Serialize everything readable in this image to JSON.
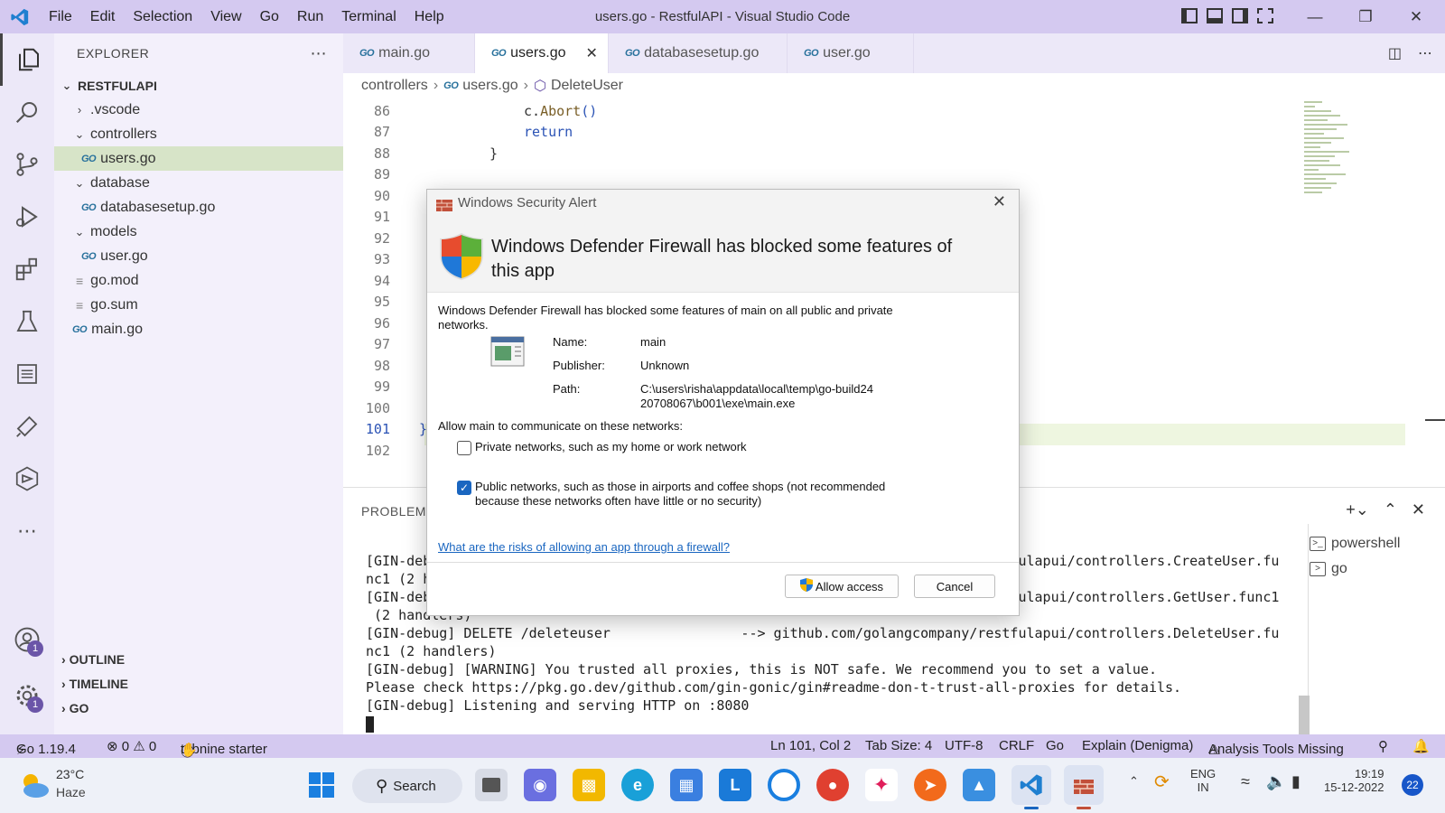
{
  "titlebar": {
    "menu": [
      "File",
      "Edit",
      "Selection",
      "View",
      "Go",
      "Run",
      "Terminal",
      "Help"
    ],
    "title": "users.go - RestfulAPI - Visual Studio Code"
  },
  "activitybar": {
    "accounts_badge": "1",
    "settings_badge": "1"
  },
  "sidebar": {
    "header": "EXPLORER",
    "root": "RESTFULAPI",
    "tree": [
      {
        "label": ".vscode"
      },
      {
        "label": "controllers"
      },
      {
        "label": "users.go"
      },
      {
        "label": "database"
      },
      {
        "label": "databasesetup.go"
      },
      {
        "label": "models"
      },
      {
        "label": "user.go"
      },
      {
        "label": "go.mod"
      },
      {
        "label": "go.sum"
      },
      {
        "label": "main.go"
      }
    ],
    "sections": [
      "OUTLINE",
      "TIMELINE",
      "GO"
    ]
  },
  "tabs": [
    {
      "label": "main.go"
    },
    {
      "label": "users.go"
    },
    {
      "label": "databasesetup.go"
    },
    {
      "label": "user.go"
    }
  ],
  "breadcrumb": [
    "controllers",
    "users.go",
    "DeleteUser"
  ],
  "editor": {
    "line_numbers": [
      "86",
      "87",
      "88",
      "89",
      "90",
      "91",
      "92",
      "93",
      "94",
      "95",
      "96",
      "97",
      "98",
      "99",
      "100",
      "101",
      "102"
    ],
    "line86_obj": "c.",
    "line86_fn": "Abort",
    "line86_paren": "()",
    "line87": "return",
    "line88": "}",
    "line101": "}"
  },
  "panel": {
    "title": "PROBLEMS",
    "terminal_lines": [
      "[GIN-debug] POST   /createuser                --> github.com/golangcompany/restfulapui/controllers.CreateUser.fu",
      "nc1 (2 handlers)",
      "[GIN-debug] GET    /getuser                   --> github.com/golangcompany/restfulapui/controllers.GetUser.func1",
      " (2 handlers)",
      "[GIN-debug] DELETE /deleteuser                --> github.com/golangcompany/restfulapui/controllers.DeleteUser.fu",
      "nc1 (2 handlers)",
      "[GIN-debug] [WARNING] You trusted all proxies, this is NOT safe. We recommend you to set a value.",
      "Please check https://pkg.go.dev/github.com/gin-gonic/gin#readme-don-t-trust-all-proxies for details.",
      "[GIN-debug] Listening and serving HTTP on :8080"
    ],
    "terminals": [
      "powershell",
      "go"
    ]
  },
  "statusbar": {
    "go_version": "Go 1.19.4",
    "problems": "⊗ 0 ⚠ 0",
    "tabnine": "tabnine starter",
    "position": "Ln 101, Col 2",
    "tab_size": "Tab Size: 4",
    "encoding": "UTF-8",
    "eol": "CRLF",
    "language": "Go",
    "explain": "Explain (Denigma)",
    "analysis": "Analysis Tools Missing"
  },
  "taskbar": {
    "temp": "23°C",
    "weather": "Haze",
    "search": "Search",
    "lang1": "ENG",
    "lang2": "IN",
    "time": "19:19",
    "date": "15-12-2022",
    "notifications": "22"
  },
  "dialog": {
    "title": "Windows Security Alert",
    "heading": "Windows Defender Firewall has blocked some features of this app",
    "body": "Windows Defender Firewall has blocked some features of main on all public and private networks.",
    "name_label": "Name:",
    "name_value": "main",
    "publisher_label": "Publisher:",
    "publisher_value": "Unknown",
    "path_label": "Path:",
    "path_value": "C:\\users\\risha\\appdata\\local\\temp\\go-build2420708067\\b001\\exe\\main.exe",
    "allow_text": "Allow main to communicate on these networks:",
    "private_label": "Private networks, such as my home or work network",
    "private_checked": false,
    "public_label": "Public networks, such as those in airports and coffee shops (not recommended because these networks often have little or no security)",
    "public_checked": true,
    "risk_link": "What are the risks of allowing an app through a firewall?",
    "allow_button": "Allow access",
    "cancel_button": "Cancel"
  },
  "colors": {
    "titlebar": "#d4c9f0",
    "activitybar": "#ece8f8",
    "sidebar": "#f3f0fb",
    "selected_row": "#d7e4c8",
    "accent": "#1a66c0"
  }
}
